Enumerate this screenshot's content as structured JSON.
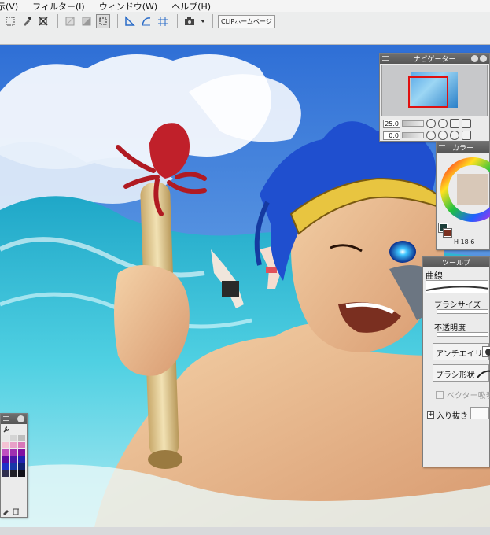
{
  "menu": {
    "items": [
      {
        "label": "示(V)"
      },
      {
        "label": "フィルター(I)"
      },
      {
        "label": "ウィンドウ(W)"
      },
      {
        "label": "ヘルプ(H)"
      }
    ]
  },
  "toolbar": {
    "clip_label": "CLIPホームページ",
    "icons": [
      "transform-icon",
      "pick-color-icon",
      "resize-icon",
      "clear-icon",
      "fill-icon",
      "selection-icon",
      "ruler-icon",
      "curve-ruler-icon",
      "perspective-ruler-icon",
      "camera-icon"
    ]
  },
  "navigator": {
    "title": "ナビゲーター",
    "zoom": "25.0",
    "rotation": "0.0"
  },
  "color_panel": {
    "title": "カラー",
    "main_color": "#1c3e3a",
    "sub_color": "#7a3020",
    "value_h": "18",
    "value_s": "6"
  },
  "tool_property": {
    "title": "ツールプ",
    "tool_name": "曲線",
    "brush_size_label": "ブラシサイズ",
    "opacity_label": "不透明度",
    "antialias_label": "アンチエイリア",
    "brush_shape_label": "ブラシ形状",
    "vector_snap_label": "ベクター吸着",
    "taper_label": "入り抜き"
  },
  "palette": {
    "colors": [
      "#e8e8e8",
      "#d4d4d4",
      "#bdbdbd",
      "#f4c2d4",
      "#e8a0c8",
      "#d878b8",
      "#c050c0",
      "#a030b0",
      "#8010a0",
      "#6008a0",
      "#4818a8",
      "#2020b0",
      "#2030c8",
      "#1838a8",
      "#102070",
      "#303050",
      "#202028",
      "#101018"
    ]
  },
  "artwork": {
    "description_colors": {
      "sky": "#4d92e3",
      "sea": "#1aa9c9",
      "hair": "#1f4fcf",
      "skin": "#e8b88c",
      "octopus": "#c0202a"
    }
  }
}
